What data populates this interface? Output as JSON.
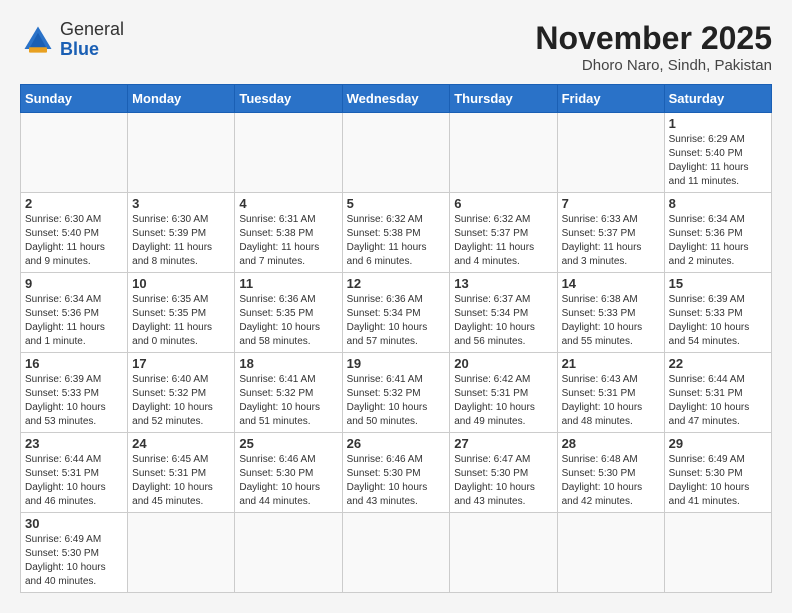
{
  "header": {
    "logo_general": "General",
    "logo_blue": "Blue",
    "month_title": "November 2025",
    "location": "Dhoro Naro, Sindh, Pakistan"
  },
  "weekdays": [
    "Sunday",
    "Monday",
    "Tuesday",
    "Wednesday",
    "Thursday",
    "Friday",
    "Saturday"
  ],
  "weeks": [
    [
      {
        "day": "",
        "info": ""
      },
      {
        "day": "",
        "info": ""
      },
      {
        "day": "",
        "info": ""
      },
      {
        "day": "",
        "info": ""
      },
      {
        "day": "",
        "info": ""
      },
      {
        "day": "",
        "info": ""
      },
      {
        "day": "1",
        "info": "Sunrise: 6:29 AM\nSunset: 5:40 PM\nDaylight: 11 hours\nand 11 minutes."
      }
    ],
    [
      {
        "day": "2",
        "info": "Sunrise: 6:30 AM\nSunset: 5:40 PM\nDaylight: 11 hours\nand 9 minutes."
      },
      {
        "day": "3",
        "info": "Sunrise: 6:30 AM\nSunset: 5:39 PM\nDaylight: 11 hours\nand 8 minutes."
      },
      {
        "day": "4",
        "info": "Sunrise: 6:31 AM\nSunset: 5:38 PM\nDaylight: 11 hours\nand 7 minutes."
      },
      {
        "day": "5",
        "info": "Sunrise: 6:32 AM\nSunset: 5:38 PM\nDaylight: 11 hours\nand 6 minutes."
      },
      {
        "day": "6",
        "info": "Sunrise: 6:32 AM\nSunset: 5:37 PM\nDaylight: 11 hours\nand 4 minutes."
      },
      {
        "day": "7",
        "info": "Sunrise: 6:33 AM\nSunset: 5:37 PM\nDaylight: 11 hours\nand 3 minutes."
      },
      {
        "day": "8",
        "info": "Sunrise: 6:34 AM\nSunset: 5:36 PM\nDaylight: 11 hours\nand 2 minutes."
      }
    ],
    [
      {
        "day": "9",
        "info": "Sunrise: 6:34 AM\nSunset: 5:36 PM\nDaylight: 11 hours\nand 1 minute."
      },
      {
        "day": "10",
        "info": "Sunrise: 6:35 AM\nSunset: 5:35 PM\nDaylight: 11 hours\nand 0 minutes."
      },
      {
        "day": "11",
        "info": "Sunrise: 6:36 AM\nSunset: 5:35 PM\nDaylight: 10 hours\nand 58 minutes."
      },
      {
        "day": "12",
        "info": "Sunrise: 6:36 AM\nSunset: 5:34 PM\nDaylight: 10 hours\nand 57 minutes."
      },
      {
        "day": "13",
        "info": "Sunrise: 6:37 AM\nSunset: 5:34 PM\nDaylight: 10 hours\nand 56 minutes."
      },
      {
        "day": "14",
        "info": "Sunrise: 6:38 AM\nSunset: 5:33 PM\nDaylight: 10 hours\nand 55 minutes."
      },
      {
        "day": "15",
        "info": "Sunrise: 6:39 AM\nSunset: 5:33 PM\nDaylight: 10 hours\nand 54 minutes."
      }
    ],
    [
      {
        "day": "16",
        "info": "Sunrise: 6:39 AM\nSunset: 5:33 PM\nDaylight: 10 hours\nand 53 minutes."
      },
      {
        "day": "17",
        "info": "Sunrise: 6:40 AM\nSunset: 5:32 PM\nDaylight: 10 hours\nand 52 minutes."
      },
      {
        "day": "18",
        "info": "Sunrise: 6:41 AM\nSunset: 5:32 PM\nDaylight: 10 hours\nand 51 minutes."
      },
      {
        "day": "19",
        "info": "Sunrise: 6:41 AM\nSunset: 5:32 PM\nDaylight: 10 hours\nand 50 minutes."
      },
      {
        "day": "20",
        "info": "Sunrise: 6:42 AM\nSunset: 5:31 PM\nDaylight: 10 hours\nand 49 minutes."
      },
      {
        "day": "21",
        "info": "Sunrise: 6:43 AM\nSunset: 5:31 PM\nDaylight: 10 hours\nand 48 minutes."
      },
      {
        "day": "22",
        "info": "Sunrise: 6:44 AM\nSunset: 5:31 PM\nDaylight: 10 hours\nand 47 minutes."
      }
    ],
    [
      {
        "day": "23",
        "info": "Sunrise: 6:44 AM\nSunset: 5:31 PM\nDaylight: 10 hours\nand 46 minutes."
      },
      {
        "day": "24",
        "info": "Sunrise: 6:45 AM\nSunset: 5:31 PM\nDaylight: 10 hours\nand 45 minutes."
      },
      {
        "day": "25",
        "info": "Sunrise: 6:46 AM\nSunset: 5:30 PM\nDaylight: 10 hours\nand 44 minutes."
      },
      {
        "day": "26",
        "info": "Sunrise: 6:46 AM\nSunset: 5:30 PM\nDaylight: 10 hours\nand 43 minutes."
      },
      {
        "day": "27",
        "info": "Sunrise: 6:47 AM\nSunset: 5:30 PM\nDaylight: 10 hours\nand 43 minutes."
      },
      {
        "day": "28",
        "info": "Sunrise: 6:48 AM\nSunset: 5:30 PM\nDaylight: 10 hours\nand 42 minutes."
      },
      {
        "day": "29",
        "info": "Sunrise: 6:49 AM\nSunset: 5:30 PM\nDaylight: 10 hours\nand 41 minutes."
      }
    ],
    [
      {
        "day": "30",
        "info": "Sunrise: 6:49 AM\nSunset: 5:30 PM\nDaylight: 10 hours\nand 40 minutes."
      },
      {
        "day": "",
        "info": ""
      },
      {
        "day": "",
        "info": ""
      },
      {
        "day": "",
        "info": ""
      },
      {
        "day": "",
        "info": ""
      },
      {
        "day": "",
        "info": ""
      },
      {
        "day": "",
        "info": ""
      }
    ]
  ]
}
